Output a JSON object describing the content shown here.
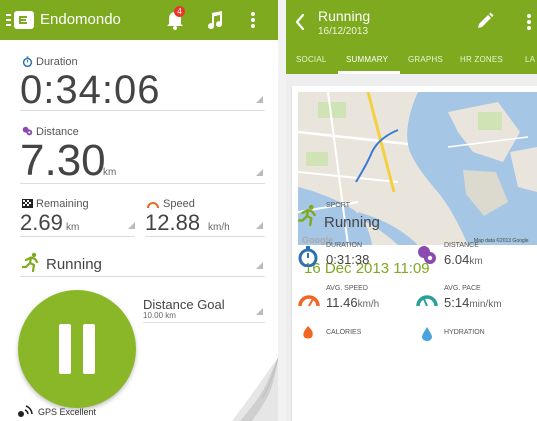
{
  "left": {
    "app_title": "Endomondo",
    "notification_count": "4",
    "duration": {
      "label": "Duration",
      "value": "0:34:06"
    },
    "distance": {
      "label": "Distance",
      "value": "7.30",
      "unit": "km"
    },
    "remaining": {
      "label": "Remaining",
      "value": "2.69",
      "unit": "km"
    },
    "speed": {
      "label": "Speed",
      "value": "12.88",
      "unit": "km/h"
    },
    "sport": "Running",
    "goal": {
      "label": "Distance Goal",
      "value": "10.00 km"
    },
    "gps_status": "GPS Excellent",
    "icons": [
      "menu-icon",
      "endomondo-logo-icon",
      "bell-icon",
      "music-note-icon",
      "overflow-menu-icon",
      "stopwatch-icon",
      "map-pin-icon",
      "checkered-flag-icon",
      "speedometer-icon",
      "running-figure-icon",
      "pause-icon",
      "gps-signal-icon"
    ],
    "colors": {
      "brand": "#7daa1f",
      "badge": "#e53a2a",
      "duration_icon": "#2f6fb3",
      "distance_icon": "#8b4ab0",
      "speed_icon": "#f26522"
    }
  },
  "right": {
    "title": "Running",
    "subtitle": "16/12/2013",
    "tabs": [
      {
        "label": "SOCIAL",
        "active": false
      },
      {
        "label": "SUMMARY",
        "active": true
      },
      {
        "label": "GRAPHS",
        "active": false
      },
      {
        "label": "HR ZONES",
        "active": false
      },
      {
        "label": "LA",
        "active": false
      }
    ],
    "map": {
      "attribution": "Map data ©2013 Google",
      "provider": "Google",
      "place_labels": [
        "København K",
        "Indre By",
        "Vesterbro",
        "Ny Carlsberg Glyptotek",
        "Islands Brygge",
        "Christianshavn",
        "Holmen"
      ]
    },
    "date": "16 Dec 2013 11:09",
    "sport": {
      "label": "SPORT",
      "value": "Running"
    },
    "metrics": {
      "duration": {
        "label": "DURATION",
        "value": "0:31:38"
      },
      "distance": {
        "label": "DISTANCE",
        "value": "6.04",
        "unit": "km"
      },
      "avg_speed": {
        "label": "AVG. SPEED",
        "value": "11.46",
        "unit": "km/h"
      },
      "avg_pace": {
        "label": "AVG. PACE",
        "value": "5:14",
        "unit": "min/km"
      },
      "calories": {
        "label": "CALORIES"
      },
      "hydration": {
        "label": "HYDRATION"
      }
    },
    "icons": [
      "back-arrow-icon",
      "pencil-edit-icon",
      "overflow-menu-icon",
      "running-figure-icon",
      "stopwatch-icon",
      "map-pin-icon",
      "speedometer-icon",
      "gauge-icon",
      "flame-icon",
      "water-drop-icon"
    ]
  }
}
